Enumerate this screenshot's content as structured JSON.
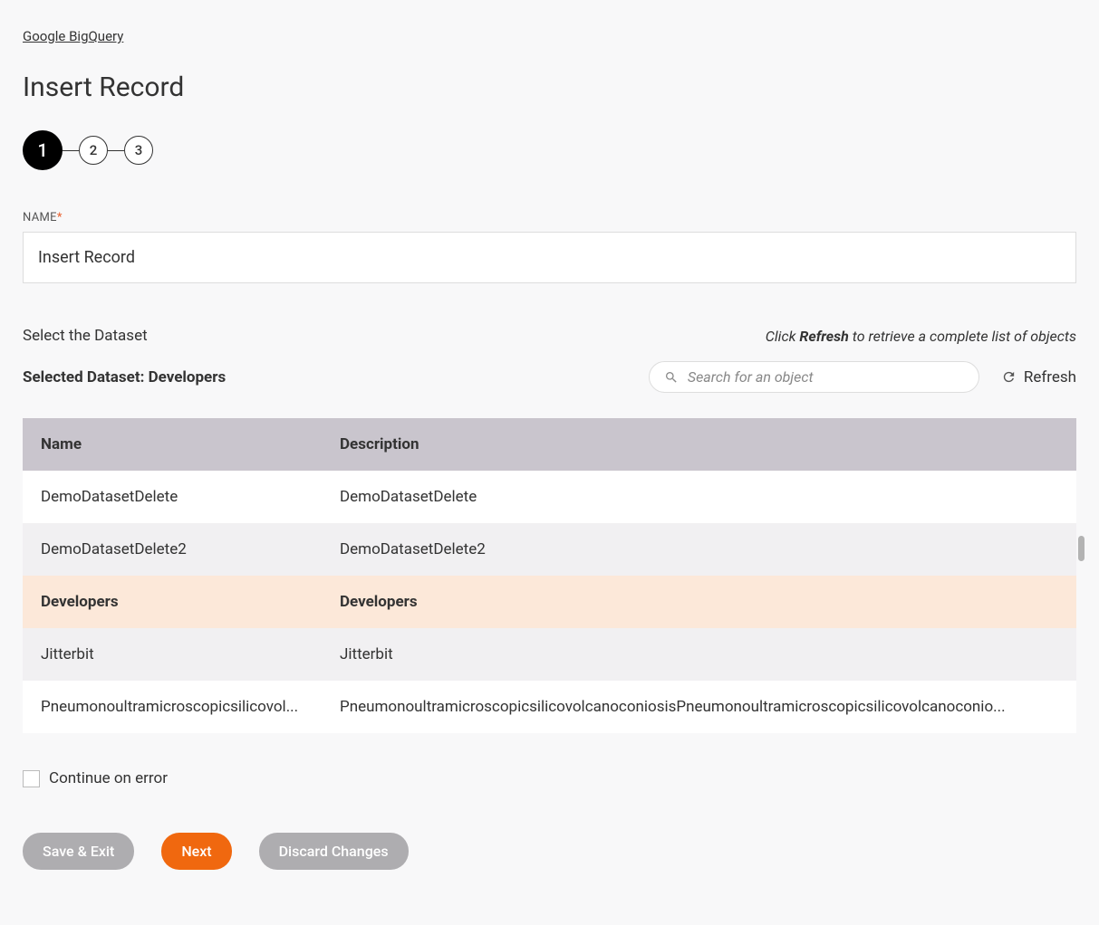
{
  "breadcrumb": "Google BigQuery",
  "page_title": "Insert Record",
  "stepper": {
    "steps": [
      "1",
      "2",
      "3"
    ],
    "active_index": 0
  },
  "name_field": {
    "label": "NAME",
    "required_marker": "*",
    "value": "Insert Record"
  },
  "dataset_section": {
    "label": "Select the Dataset",
    "hint_prefix": "Click ",
    "hint_bold": "Refresh",
    "hint_suffix": " to retrieve a complete list of objects",
    "selected_label": "Selected Dataset: Developers",
    "search_placeholder": "Search for an object",
    "refresh_label": "Refresh"
  },
  "table": {
    "columns": [
      "Name",
      "Description"
    ],
    "rows": [
      {
        "name": "DemoDatasetDelete",
        "description": "DemoDatasetDelete",
        "selected": false
      },
      {
        "name": "DemoDatasetDelete2",
        "description": "DemoDatasetDelete2",
        "selected": false
      },
      {
        "name": "Developers",
        "description": "Developers",
        "selected": true
      },
      {
        "name": "Jitterbit",
        "description": "Jitterbit",
        "selected": false
      },
      {
        "name": "Pneumonoultramicroscopicsilicovol...",
        "description": "PneumonoultramicroscopicsilicovolcanoconiosisPneumonoultramicroscopicsilicovolcanoconio...",
        "selected": false
      }
    ]
  },
  "continue_checkbox": {
    "label": "Continue on error",
    "checked": false
  },
  "buttons": {
    "save_exit": "Save & Exit",
    "next": "Next",
    "discard": "Discard Changes"
  }
}
